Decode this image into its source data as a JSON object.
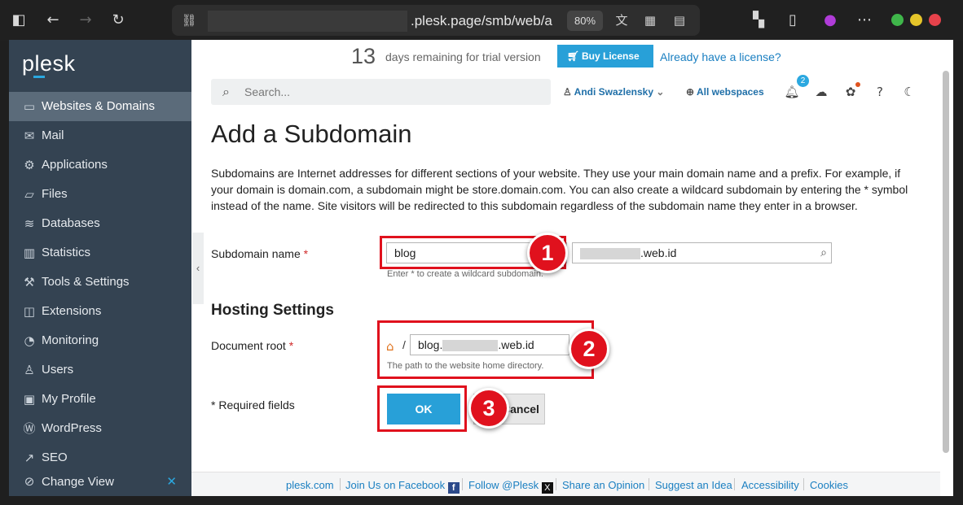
{
  "browser": {
    "url_domain": ".plesk.page/smb/web/a",
    "zoom": "80%"
  },
  "sidebar": {
    "logo": "plesk",
    "items": [
      {
        "label": "Websites & Domains",
        "icon": "monitor-icon"
      },
      {
        "label": "Mail",
        "icon": "mail-icon"
      },
      {
        "label": "Applications",
        "icon": "gear-icon"
      },
      {
        "label": "Files",
        "icon": "folder-icon"
      },
      {
        "label": "Databases",
        "icon": "database-icon"
      },
      {
        "label": "Statistics",
        "icon": "bar-chart-icon"
      },
      {
        "label": "Tools & Settings",
        "icon": "tools-icon"
      },
      {
        "label": "Extensions",
        "icon": "puzzle-icon"
      },
      {
        "label": "Monitoring",
        "icon": "monitoring-icon"
      },
      {
        "label": "Users",
        "icon": "user-icon"
      },
      {
        "label": "My Profile",
        "icon": "profile-icon"
      },
      {
        "label": "WordPress",
        "icon": "wordpress-icon"
      },
      {
        "label": "SEO",
        "icon": "seo-icon"
      }
    ],
    "change_view": "Change View"
  },
  "trial": {
    "days": "13",
    "text": "days remaining for trial version",
    "buy_label": "Buy License",
    "already_label": "Already have a license?"
  },
  "header": {
    "search_placeholder": "Search...",
    "user_name": "Andi Swazlensky",
    "webspaces": "All webspaces",
    "notification_count": "2"
  },
  "main": {
    "title": "Add a Subdomain",
    "description": "Subdomains are Internet addresses for different sections of your website. They use your main domain name and a prefix. For example, if your domain is domain.com, a subdomain might be store.domain.com. You can also create a wildcard subdomain by entering the * symbol instead of the name. Site visitors will be redirected to this subdomain regardless of the subdomain name they enter in a browser.",
    "subdomain_label": "Subdomain name",
    "required_mark": "*",
    "subdomain_value": "blog",
    "domain_suffix": ".web.id",
    "subdomain_hint": "Enter * to create a wildcard subdomain.",
    "hosting_title": "Hosting Settings",
    "docroot_label": "Document root",
    "docroot_prefix": "blog.",
    "docroot_suffix": ".web.id",
    "docroot_hint": "The path to the website home directory.",
    "required_fields": "* Required fields",
    "ok_label": "OK",
    "cancel_label": "Cancel"
  },
  "annotations": [
    "1",
    "2",
    "3"
  ],
  "footer": {
    "links": [
      "plesk.com",
      "Join Us on Facebook",
      "Follow @Plesk",
      "Share an Opinion",
      "Suggest an Idea",
      "Accessibility",
      "Cookies"
    ]
  },
  "colors": {
    "sidebar_bg": "#344352",
    "accent": "#28a0d8",
    "annotation": "#e0111d"
  }
}
